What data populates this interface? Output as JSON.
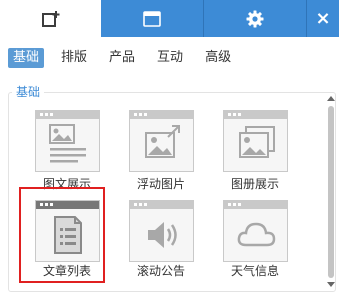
{
  "toolbar": {
    "tabs": [
      {
        "icon": "add-widget-icon",
        "active": true
      },
      {
        "icon": "window-icon",
        "active": false
      },
      {
        "icon": "gear-icon",
        "active": false
      }
    ],
    "close_icon": "close-icon",
    "close_label": "×"
  },
  "categories": {
    "items": [
      "基础",
      "排版",
      "产品",
      "互动",
      "高级"
    ],
    "active": "基础"
  },
  "section": {
    "title": "基础"
  },
  "widgets": [
    {
      "label": "图文展示",
      "icon": "image-text-icon"
    },
    {
      "label": "浮动图片",
      "icon": "floating-image-icon"
    },
    {
      "label": "图册展示",
      "icon": "gallery-icon"
    },
    {
      "label": "文章列表",
      "icon": "article-list-icon",
      "selected": true
    },
    {
      "label": "滚动公告",
      "icon": "speaker-icon"
    },
    {
      "label": "天气信息",
      "icon": "cloud-icon"
    }
  ],
  "colors": {
    "accent": "#3d8bd6",
    "active_tab": "#5b9bd5",
    "highlight": "#e02020",
    "icon_gray": "#a8a8a8"
  }
}
